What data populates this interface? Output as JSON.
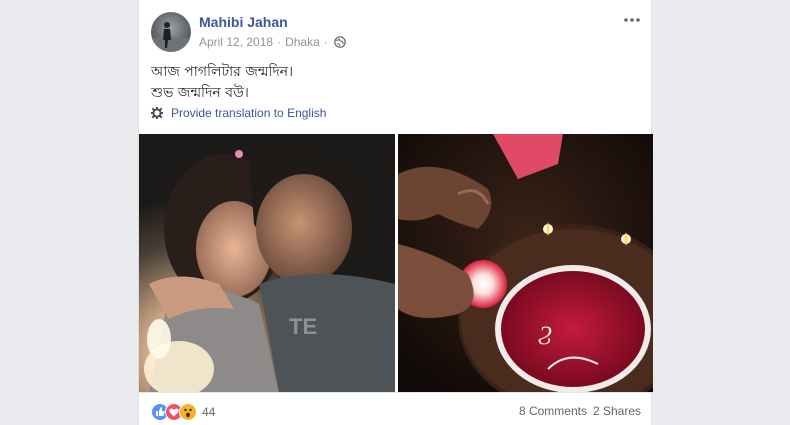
{
  "post": {
    "author": "Mahibi Jahan",
    "date": "April 12, 2018",
    "separator": "·",
    "location": "Dhaka",
    "privacy_icon": "globe-icon",
    "text_lines": [
      "আজ পাগলিটার জন্মদিন।",
      "শুভ জন্মদিন বউ।"
    ],
    "translate_label": "Provide translation to English",
    "photos": [
      {
        "name": "couple-selfie-candlelight"
      },
      {
        "name": "birthday-cake-candles"
      }
    ]
  },
  "footer": {
    "reaction_icons": [
      "like-icon",
      "love-icon",
      "wow-icon"
    ],
    "reaction_count": "44",
    "comments_label": "8 Comments",
    "shares_label": "2 Shares"
  },
  "colors": {
    "link": "#385898",
    "meta": "#90949c",
    "like": "#5890ff",
    "love": "#f25268",
    "wow": "#f7b125"
  }
}
